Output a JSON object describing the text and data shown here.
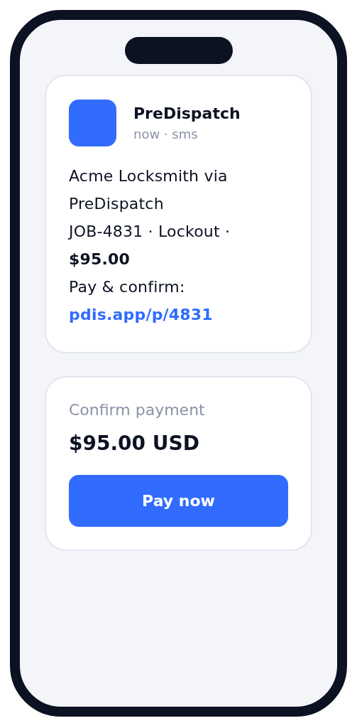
{
  "notification": {
    "app_name": "PreDispatch",
    "meta": "now · sms",
    "lines": [
      "Acme Locksmith via PreDispatch",
      "JOB-4831 · Lockout · **$95.00**"
    ],
    "cta_text": "Pay & confirm:",
    "link": "pdis.app/p/4831"
  },
  "payment": {
    "label": "Confirm payment",
    "amount": "$95.00 USD",
    "button": "Pay now"
  }
}
